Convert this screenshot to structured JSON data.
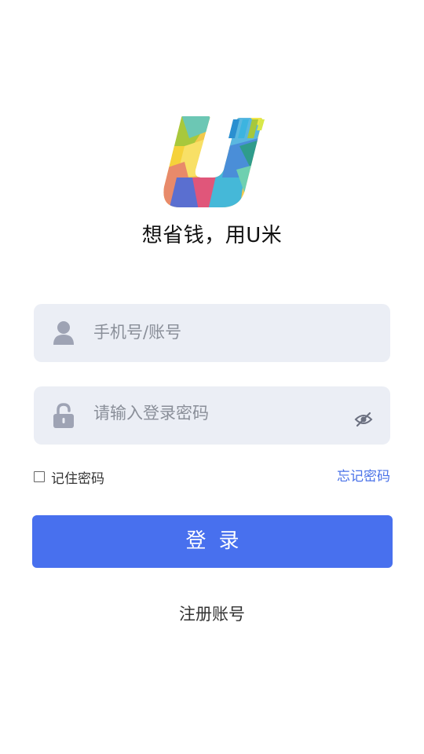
{
  "slogan": "想省钱，用U米",
  "account": {
    "placeholder": "手机号/账号",
    "icon": "user-icon",
    "icon_color": "#9ea3b4"
  },
  "password": {
    "placeholder": "请输入登录密码",
    "icon": "unlock-icon",
    "toggle_icon": "eye-off-icon"
  },
  "remember": {
    "label": "记住密码",
    "checked": false
  },
  "forgot_label": "忘记密码",
  "login_label": "登录",
  "register_label": "注册账号",
  "colors": {
    "primary": "#4870ee",
    "link": "#4a72e8",
    "field_bg": "#ebeef5"
  }
}
